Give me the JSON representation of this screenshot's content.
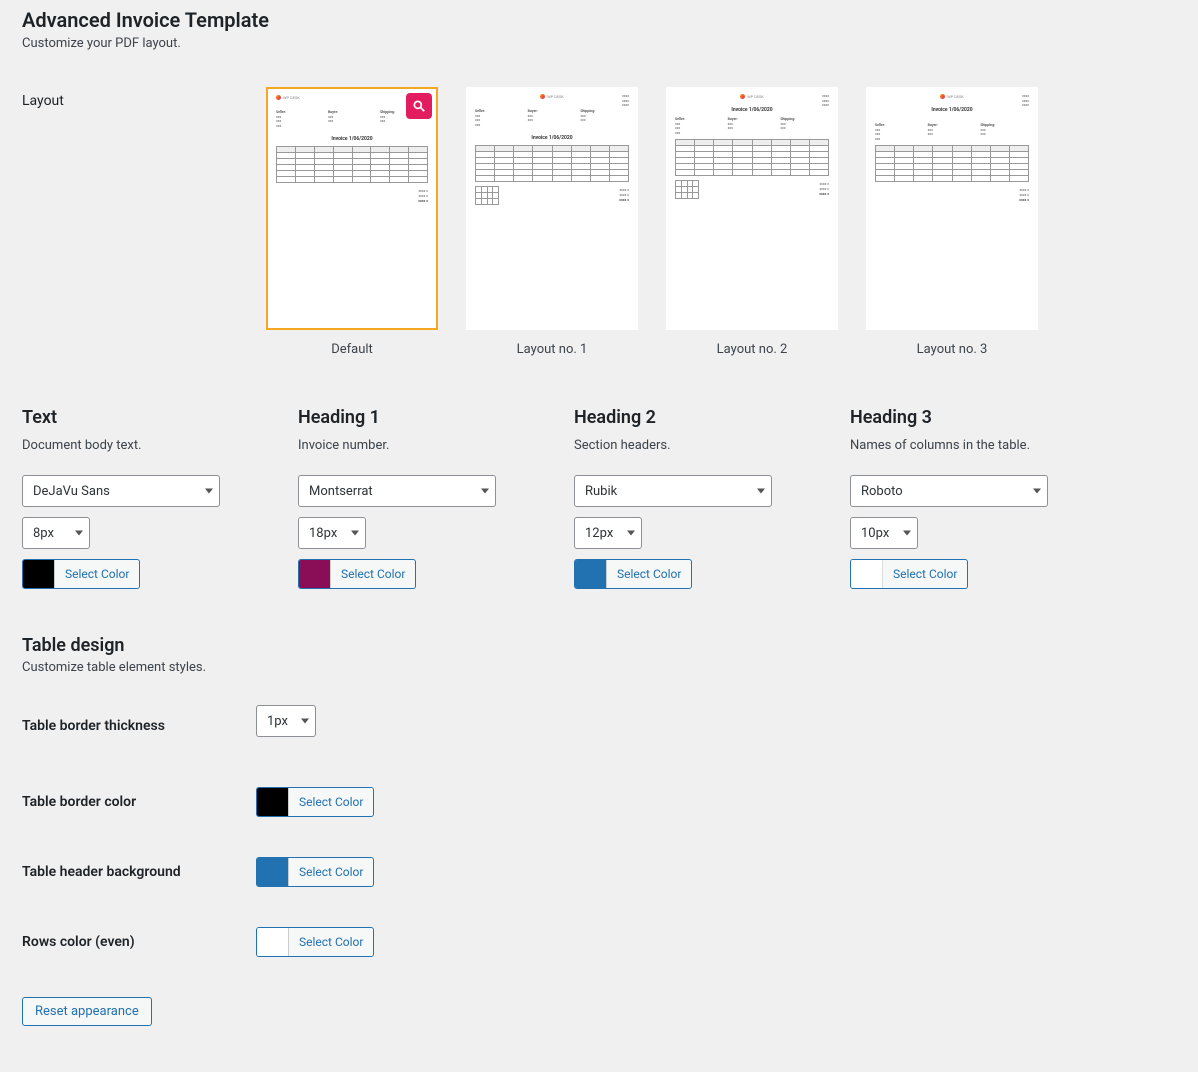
{
  "page": {
    "title": "Advanced Invoice Template",
    "subtitle": "Customize your PDF layout."
  },
  "layout": {
    "label": "Layout",
    "options": [
      {
        "caption": "Default",
        "selected": true,
        "hasZoom": true
      },
      {
        "caption": "Layout no. 1",
        "selected": false
      },
      {
        "caption": "Layout no. 2",
        "selected": false
      },
      {
        "caption": "Layout no. 3",
        "selected": false
      }
    ]
  },
  "miniInvoice": {
    "title": "Invoice 1/06/2020",
    "seller": "Seller:",
    "buyer": "Buyer:",
    "shipping": "Shipping:"
  },
  "typography": [
    {
      "title": "Text",
      "desc": "Document body text.",
      "font": "DeJaVu Sans",
      "size": "8px",
      "color": "#000000"
    },
    {
      "title": "Heading 1",
      "desc": "Invoice number.",
      "font": "Montserrat",
      "size": "18px",
      "color": "#8a0e57"
    },
    {
      "title": "Heading 2",
      "desc": "Section headers.",
      "font": "Rubik",
      "size": "12px",
      "color": "#2271b1"
    },
    {
      "title": "Heading 3",
      "desc": "Names of columns in the table.",
      "font": "Roboto",
      "size": "10px",
      "color": "#ffffff"
    }
  ],
  "labels": {
    "selectColor": "Select Color"
  },
  "tableDesign": {
    "title": "Table design",
    "subtitle": "Customize table element styles.",
    "rows": [
      {
        "key": "thickness",
        "label": "Table border thickness",
        "type": "select",
        "value": "1px"
      },
      {
        "key": "borderColor",
        "label": "Table border color",
        "type": "color",
        "value": "#000000"
      },
      {
        "key": "headerBg",
        "label": "Table header background",
        "type": "color",
        "value": "#2271b1"
      },
      {
        "key": "rowsEven",
        "label": "Rows color (even)",
        "type": "color",
        "value": "#ffffff"
      }
    ]
  },
  "reset": {
    "label": "Reset appearance"
  }
}
